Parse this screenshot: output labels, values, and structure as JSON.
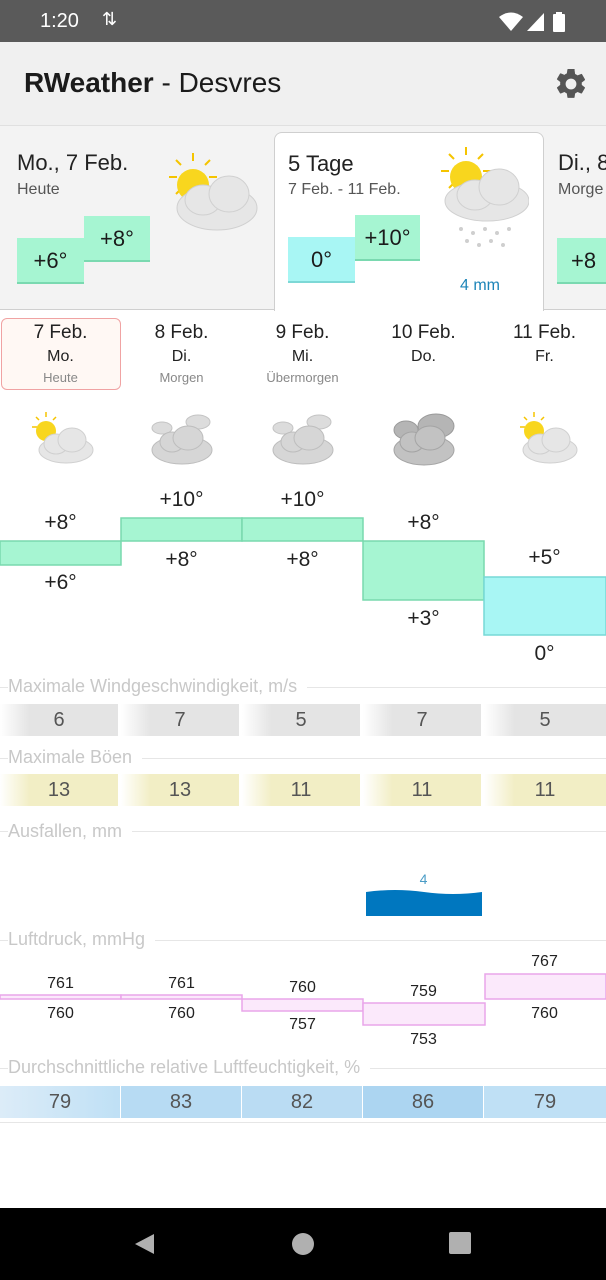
{
  "status_bar": {
    "time": "1:20",
    "sync_glyph": "⇅"
  },
  "app_bar": {
    "app_name": "RWeather",
    "separator": " - ",
    "location": "Desvres",
    "settings_icon": "gear-icon"
  },
  "cards": [
    {
      "title": "Mo., 7 Feb.",
      "subtitle": "Heute",
      "low": "+6°",
      "high": "+8°",
      "icon": "sun-cloud-icon"
    },
    {
      "title": "5 Tage",
      "subtitle": "7 Feb. - 11 Feb.",
      "low": "0°",
      "high": "+10°",
      "precip": "4 mm",
      "icon": "sun-rain-cloud-icon"
    },
    {
      "title": "Di., 8",
      "subtitle": "Morge",
      "low": "+8",
      "icon": "sun-cloud-icon"
    }
  ],
  "days": [
    {
      "date": "7 Feb.",
      "weekday": "Mo.",
      "relative": "Heute",
      "high": "+8°",
      "low": "+6°",
      "icon": "sun-cloud-icon",
      "wind": "6",
      "gusts": "13",
      "press_high": "761",
      "press_low": "760",
      "humidity": "79"
    },
    {
      "date": "8 Feb.",
      "weekday": "Di.",
      "relative": "Morgen",
      "high": "+10°",
      "low": "+8°",
      "icon": "clouds-icon",
      "wind": "7",
      "gusts": "13",
      "press_high": "761",
      "press_low": "760",
      "humidity": "83"
    },
    {
      "date": "9 Feb.",
      "weekday": "Mi.",
      "relative": "Übermorgen",
      "high": "+10°",
      "low": "+8°",
      "icon": "clouds-icon",
      "wind": "5",
      "gusts": "11",
      "press_high": "760",
      "press_low": "757",
      "humidity": "82"
    },
    {
      "date": "10 Feb.",
      "weekday": "Do.",
      "relative": "",
      "high": "+8°",
      "low": "+3°",
      "icon": "dark-clouds-icon",
      "wind": "7",
      "gusts": "11",
      "press_high": "759",
      "press_low": "753",
      "humidity": "86"
    },
    {
      "date": "11 Feb.",
      "weekday": "Fr.",
      "relative": "",
      "high": "+5°",
      "low": "0°",
      "icon": "sun-cloud-icon",
      "wind": "5",
      "gusts": "11",
      "press_high": "767",
      "press_low": "760",
      "humidity": "79"
    }
  ],
  "sections": {
    "wind": "Maximale Windgeschwindigkeit, m/s",
    "gusts": "Maximale Böen",
    "precip": "Ausfallen, mm",
    "pressure": "Luftdruck, mmHg",
    "humidity": "Durchschnittliche relative Luftfeuchtigkeit, %"
  },
  "precip_day": {
    "day": "10 Feb.",
    "value": "4"
  },
  "colors": {
    "temp_warm": "#a6f5d2",
    "temp_cold": "#a8f6f4",
    "precip": "#0077bf",
    "pressure": "#e9a6ea",
    "today_border": "#f0a3a3"
  },
  "nav": {
    "back_icon": "back-icon",
    "home_icon": "home-icon",
    "recents_icon": "recents-icon"
  }
}
